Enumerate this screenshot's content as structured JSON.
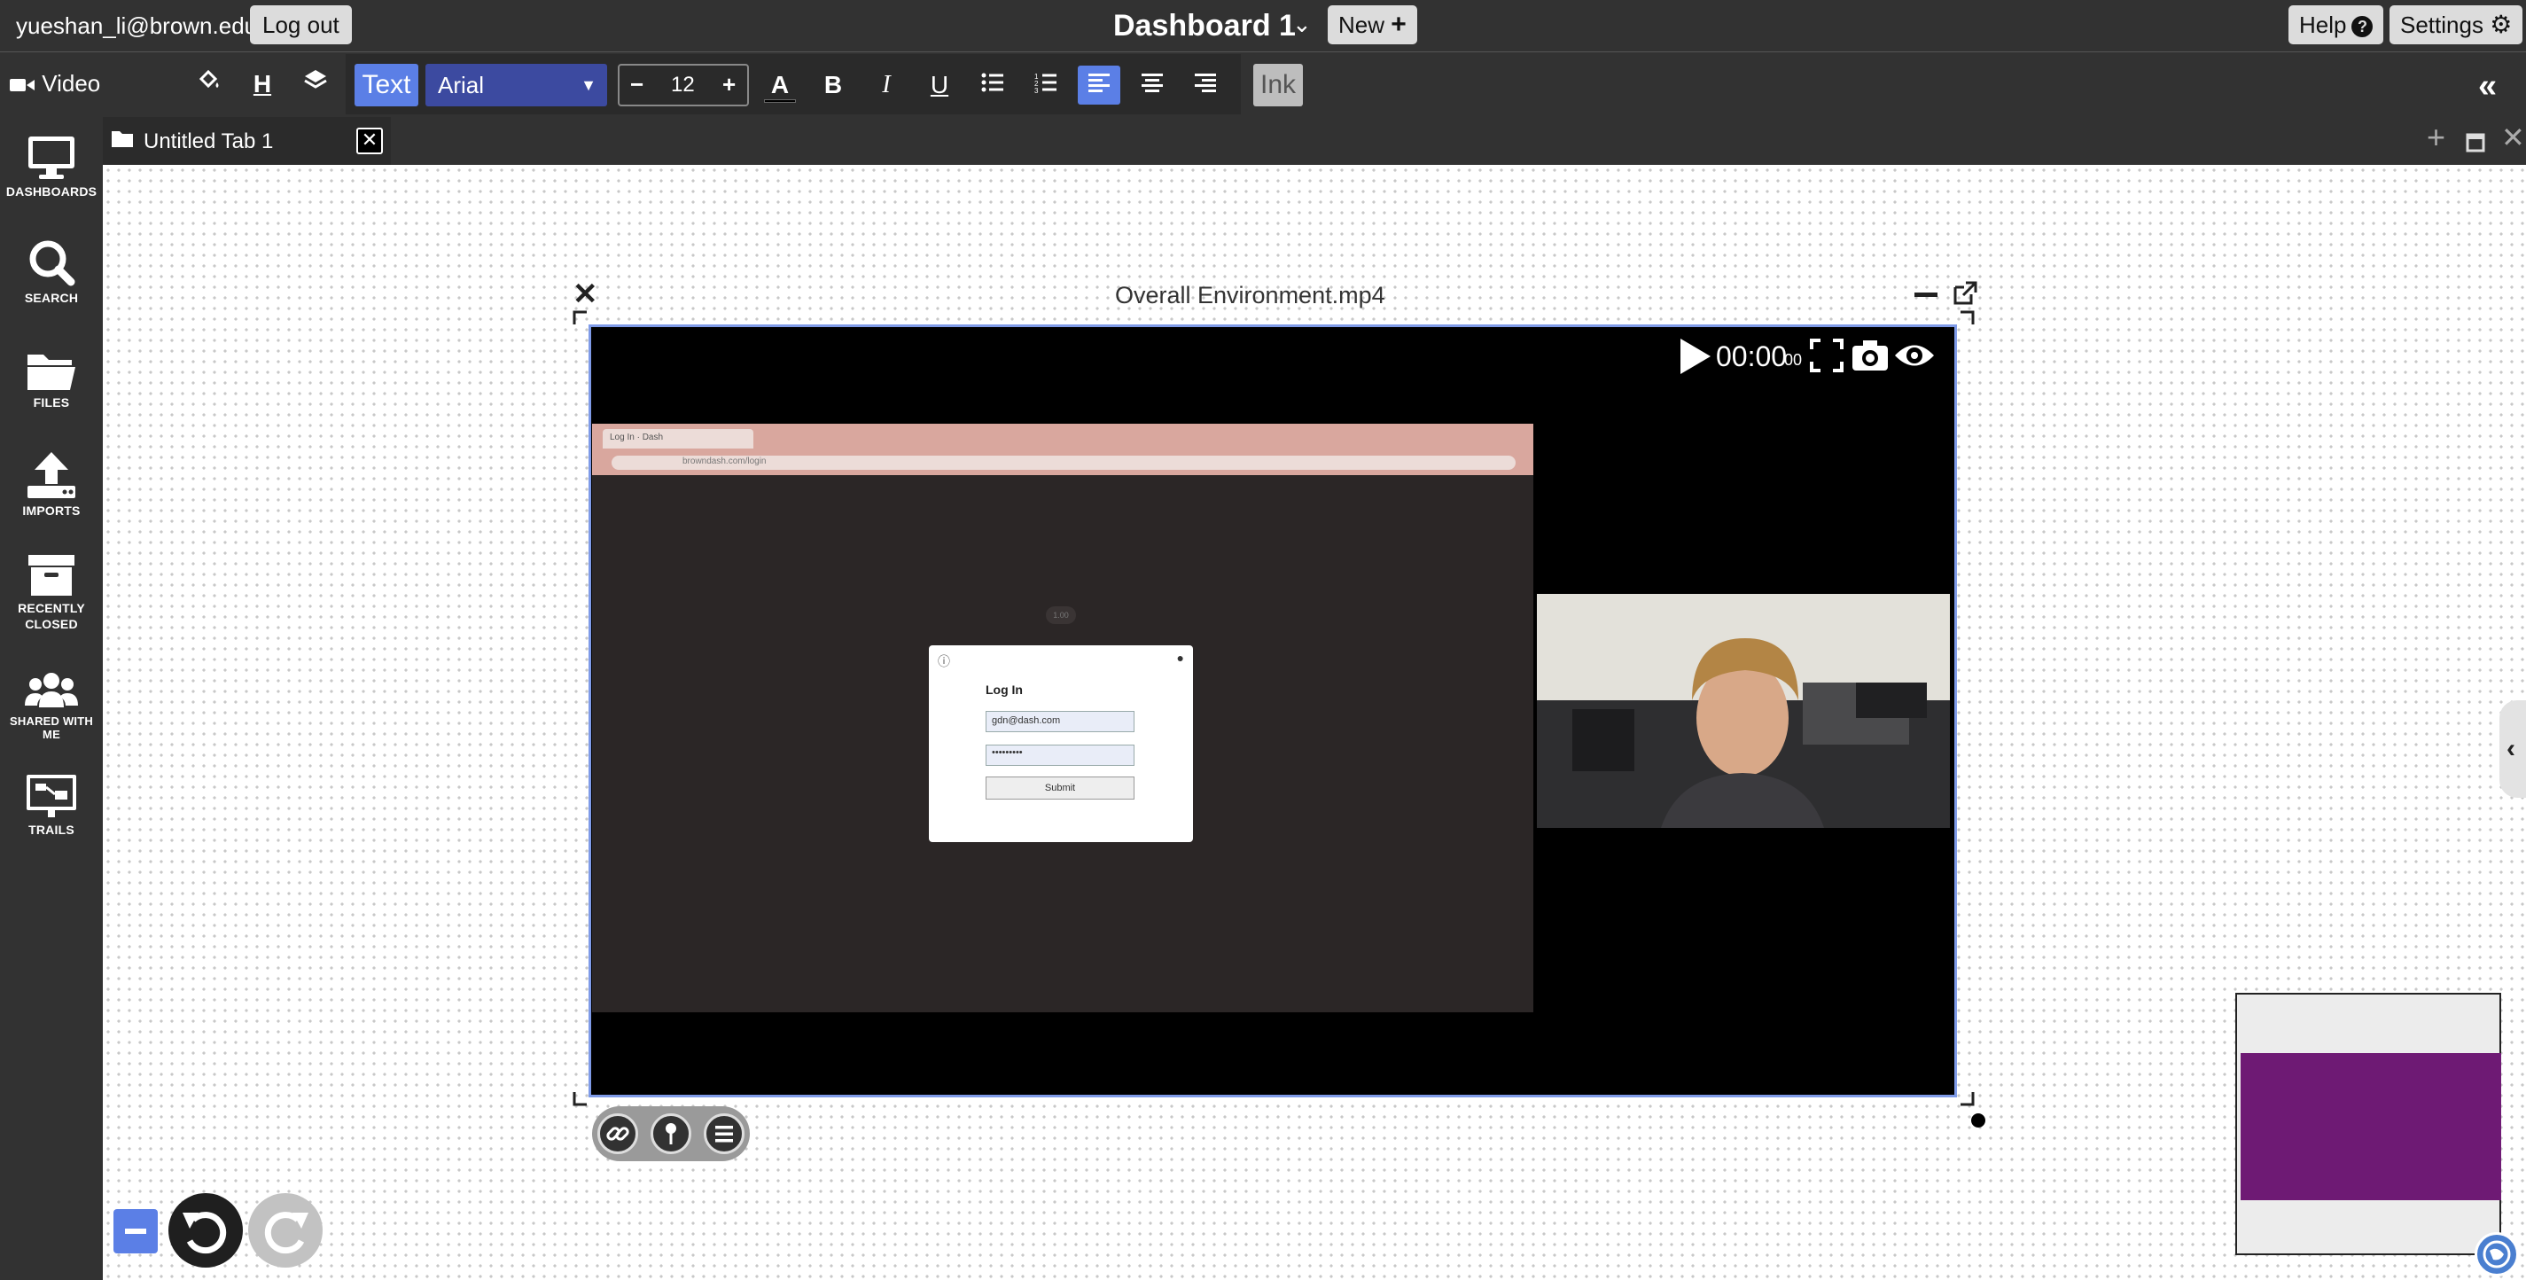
{
  "topbar": {
    "user_email": "yueshan_li@brown.edu",
    "logout_label": "Log out",
    "dashboard_title": "Dashboard 1",
    "new_label": "New",
    "help_label": "Help",
    "settings_label": "Settings"
  },
  "toolbar": {
    "mode_label": "Video",
    "text_toggle_label": "Text",
    "font_family": "Arial",
    "font_size": "12",
    "ink_label": "Ink",
    "accent_color": "#5b7fe6"
  },
  "sidebar": {
    "items": [
      {
        "label": "DASHBOARDS",
        "icon": "monitor-icon"
      },
      {
        "label": "SEARCH",
        "icon": "search-icon"
      },
      {
        "label": "FILES",
        "icon": "folder-icon"
      },
      {
        "label": "IMPORTS",
        "icon": "upload-icon"
      },
      {
        "label": "RECENTLY\nCLOSED",
        "label_line1": "RECENTLY",
        "label_line2": "CLOSED",
        "icon": "archive-icon"
      },
      {
        "label": "SHARED WITH ME",
        "icon": "users-icon"
      },
      {
        "label": "TRAILS",
        "icon": "trails-icon"
      }
    ]
  },
  "tabs": [
    {
      "label": "Untitled Tab 1",
      "active": true
    }
  ],
  "video_doc": {
    "title": "Overall Environment.mp4",
    "time_main": "00:00",
    "time_sub": "00",
    "frame_border_color": "#7f9be8"
  },
  "recording": {
    "browser_tab": "Log In · Dash",
    "browser_url": "browndash.com/login",
    "login_title": "Log In",
    "email_value": "gdn@dash.com",
    "password_value": "•••••••••",
    "submit_label": "Submit",
    "zoom_pill": "1.00"
  },
  "minimap": {
    "fill_color": "#6e1a74"
  }
}
